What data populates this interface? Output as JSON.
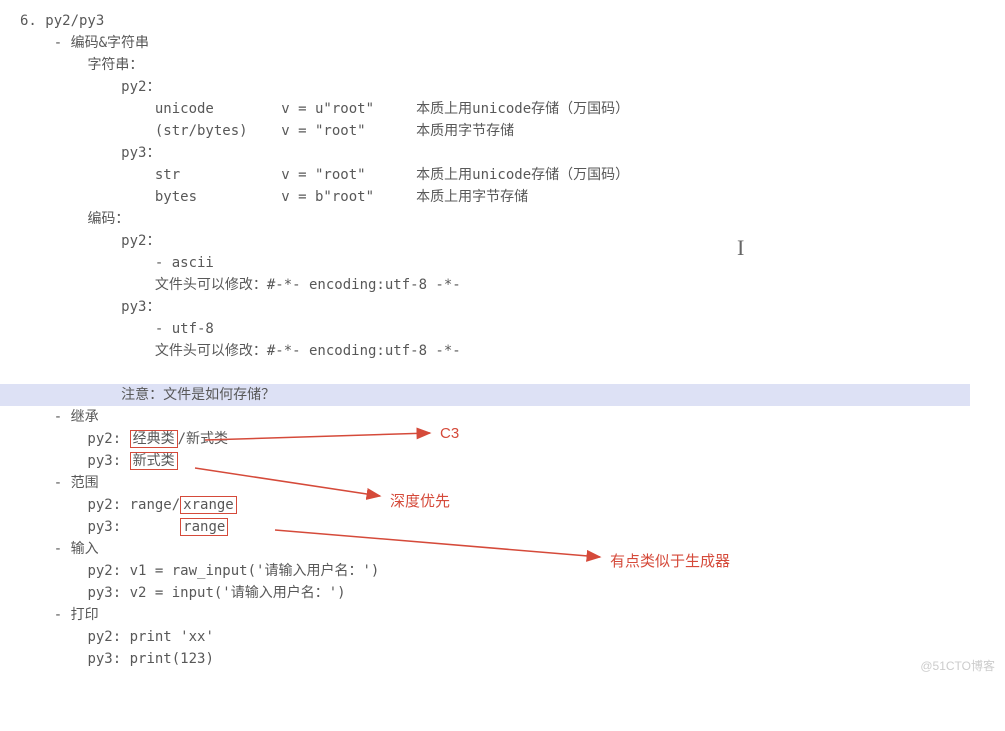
{
  "title": "6. py2/py3",
  "sec_encoding": "- 编码&字符串",
  "str_header": "字符串：",
  "py2_label": "py2：",
  "py3_label": "py3：",
  "row_unicode": "unicode        v = u\"root\"     本质上用unicode存储（万国码）",
  "row_strbytes": "(str/bytes)    v = \"root\"      本质用字节存储",
  "row_str": "str            v = \"root\"      本质上用unicode存储（万国码）",
  "row_bytes": "bytes          v = b\"root\"     本质上用字节存储",
  "encoding_header": "编码：",
  "ascii_item": "- ascii",
  "file_head_py2": "文件头可以修改：#-*- encoding:utf-8 -*-",
  "utf8_item": "- utf-8",
  "file_head_py3": "文件头可以修改：#-*- encoding:utf-8 -*-",
  "note": "注意：文件是如何存储？",
  "sec_inherit": "- 继承",
  "inherit_py2_a": "经典类",
  "inherit_py2_b": "/新式类",
  "inherit_py3": "新式类",
  "sec_range": "- 范围",
  "range_py2_a": "py2: range/",
  "range_py2_b": "xrange",
  "range_py3_a": "py3:       ",
  "range_py3_b": "range",
  "sec_input": "- 输入",
  "input_py2": "py2: v1 = raw_input('请输入用户名：')",
  "input_py3": "py3: v2 = input('请输入用户名：')",
  "sec_print": "- 打印",
  "print_py2": "py2: print 'xx'",
  "print_py3": "py3: print(123)",
  "anno_c3": "C3",
  "anno_depth": "深度优先",
  "anno_gen": "有点类似于生成器",
  "watermark": "@51CTO博客"
}
